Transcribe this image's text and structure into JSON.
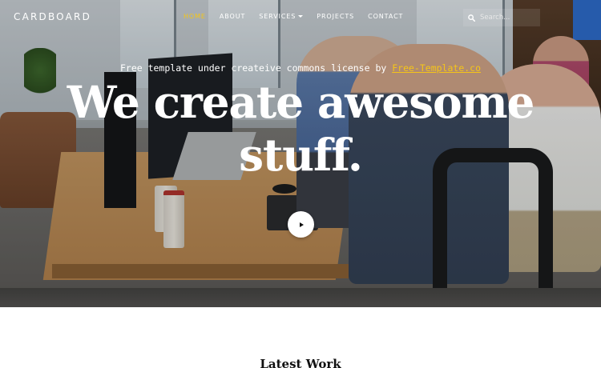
{
  "brand": "CARDBOARD",
  "nav": {
    "items": [
      {
        "label": "HOME",
        "active": true
      },
      {
        "label": "ABOUT"
      },
      {
        "label": "SERVICES",
        "dropdown": true
      },
      {
        "label": "PROJECTS"
      },
      {
        "label": "CONTACT"
      }
    ]
  },
  "search": {
    "placeholder": "Search...",
    "icon": "search-icon"
  },
  "hero": {
    "tagline_prefix": "Free template under createive commons license by ",
    "tagline_link": "Free-Template.co",
    "headline_line1": "We create awesome",
    "headline_line2": "stuff.",
    "play_icon": "play-icon"
  },
  "section": {
    "title": "Latest Work"
  },
  "colors": {
    "accent": "#f5c518",
    "text_light": "#ffffff",
    "text_dark": "#111111"
  }
}
